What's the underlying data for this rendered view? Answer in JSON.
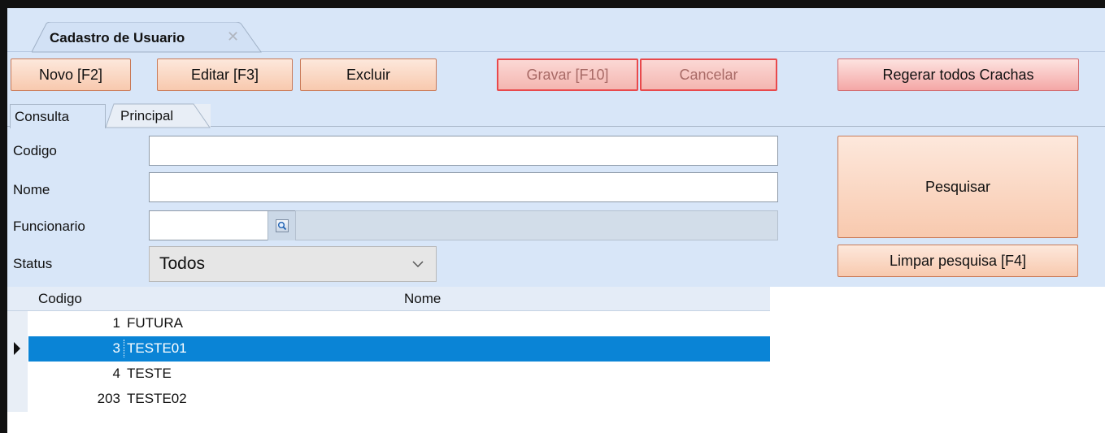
{
  "document_tab": {
    "title": "Cadastro de Usuario",
    "close_glyph": "✕"
  },
  "toolbar": {
    "novo": "Novo [F2]",
    "editar": "Editar [F3]",
    "excluir": "Excluir",
    "gravar": "Gravar [F10]",
    "cancelar": "Cancelar",
    "regerar": "Regerar todos Crachas"
  },
  "subtabs": {
    "consulta": "Consulta",
    "principal": "Principal"
  },
  "form": {
    "codigo_label": "Codigo",
    "codigo_value": "",
    "nome_label": "Nome",
    "nome_value": "",
    "funcionario_label": "Funcionario",
    "funcionario_value": "",
    "status_label": "Status",
    "status_value": "Todos"
  },
  "actions": {
    "pesquisar": "Pesquisar",
    "limpar": "Limpar pesquisa [F4]"
  },
  "grid": {
    "columns": [
      "Codigo",
      "Nome"
    ],
    "rows": [
      {
        "codigo": "1",
        "nome": "FUTURA"
      },
      {
        "codigo": "3",
        "nome": "TESTE01",
        "selected": true
      },
      {
        "codigo": "4",
        "nome": "TESTE"
      },
      {
        "codigo": "203",
        "nome": "TESTE02"
      }
    ]
  },
  "colors": {
    "selection": "#0a84d6",
    "panel": "#d8e6f8",
    "button": "#f8c9ae",
    "disabled_border": "#e8494c"
  },
  "icons": {
    "lookup": "search-icon",
    "dropdown": "chevron-down-icon",
    "row_pointer": "row-pointer-icon"
  }
}
